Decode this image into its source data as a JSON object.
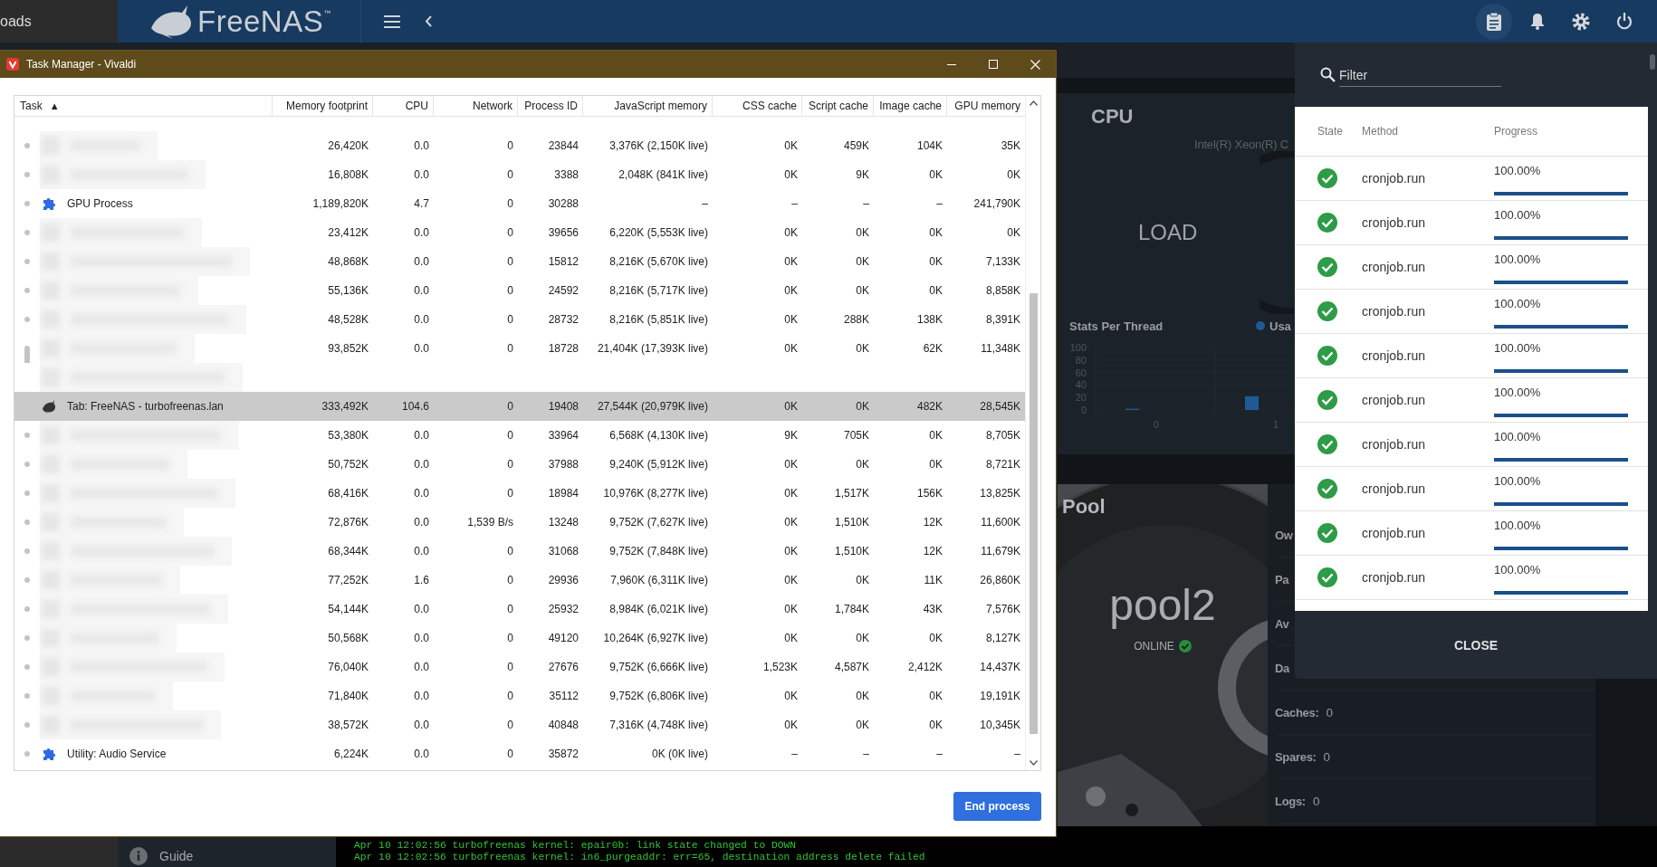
{
  "topbar": {
    "sidebar_fragment": "oads",
    "logo": "FreeNAS$^{™}$",
    "icons": [
      {
        "kind": "clipboard",
        "selected": true
      },
      {
        "kind": "bell",
        "selected": false
      },
      {
        "kind": "gear",
        "selected": false
      },
      {
        "kind": "power",
        "selected": false
      }
    ]
  },
  "task_manager": {
    "title": "Task Manager - Vivaldi",
    "columns": [
      {
        "label": "Task",
        "sort_indicator": "▲"
      },
      {
        "label": "Memory footprint"
      },
      {
        "label": "CPU"
      },
      {
        "label": "Network"
      },
      {
        "label": "Process ID"
      },
      {
        "label": "JavaScript memory"
      },
      {
        "label": "CSS cache"
      },
      {
        "label": "Script cache"
      },
      {
        "label": "Image cache"
      },
      {
        "label": "GPU memory"
      }
    ],
    "rows": [
      {
        "kind": "blurred",
        "dot": true,
        "grouped": false,
        "selected": false,
        "values": [
          "26,420K",
          "0.0",
          "0",
          "23844",
          "3,376K (2,150K live)",
          "0K",
          "459K",
          "104K",
          "35K"
        ]
      },
      {
        "kind": "blurred",
        "dot": true,
        "grouped": false,
        "selected": false,
        "values": [
          "16,808K",
          "0.0",
          "0",
          "3388",
          "2,048K (841K live)",
          "0K",
          "9K",
          "0K",
          "0K"
        ]
      },
      {
        "kind": "extension",
        "dot": true,
        "grouped": false,
        "selected": false,
        "task": "GPU Process",
        "values": [
          "1,189,820K",
          "4.7",
          "0",
          "30288",
          "–",
          "–",
          "–",
          "–",
          "241,790K"
        ]
      },
      {
        "kind": "blurred",
        "dot": true,
        "grouped": false,
        "selected": false,
        "values": [
          "23,412K",
          "0.0",
          "0",
          "39656",
          "6,220K (5,553K live)",
          "0K",
          "0K",
          "0K",
          "0K"
        ]
      },
      {
        "kind": "blurred",
        "dot": true,
        "grouped": false,
        "selected": false,
        "values": [
          "48,868K",
          "0.0",
          "0",
          "15812",
          "8,216K (5,670K live)",
          "0K",
          "0K",
          "0K",
          "7,133K"
        ]
      },
      {
        "kind": "blurred",
        "dot": true,
        "grouped": false,
        "selected": false,
        "values": [
          "55,136K",
          "0.0",
          "0",
          "24592",
          "8,216K (5,717K live)",
          "0K",
          "0K",
          "0K",
          "8,858K"
        ]
      },
      {
        "kind": "blurred",
        "dot": true,
        "grouped": false,
        "selected": false,
        "values": [
          "48,528K",
          "0.0",
          "0",
          "28732",
          "8,216K (5,851K live)",
          "0K",
          "288K",
          "138K",
          "8,391K"
        ]
      },
      {
        "kind": "blurred",
        "dot": false,
        "grouped": true,
        "selected": false,
        "values": [
          "93,852K",
          "0.0",
          "0",
          "18728",
          "21,404K (17,393K live)",
          "0K",
          "0K",
          "62K",
          "11,348K"
        ]
      },
      {
        "kind": "blurred",
        "dot": false,
        "grouped": false,
        "selected": false
      },
      {
        "kind": "tab",
        "dot": false,
        "grouped": false,
        "selected": true,
        "task": "Tab: FreeNAS - turbofreenas.lan",
        "values": [
          "333,492K",
          "104.6",
          "0",
          "19408",
          "27,544K (20,979K live)",
          "0K",
          "0K",
          "482K",
          "28,545K"
        ]
      },
      {
        "kind": "blurred",
        "dot": true,
        "grouped": false,
        "selected": false,
        "values": [
          "53,380K",
          "0.0",
          "0",
          "33964",
          "6,568K (4,130K live)",
          "9K",
          "705K",
          "0K",
          "8,705K"
        ]
      },
      {
        "kind": "blurred",
        "dot": true,
        "grouped": false,
        "selected": false,
        "values": [
          "50,752K",
          "0.0",
          "0",
          "37988",
          "9,240K (5,912K live)",
          "0K",
          "0K",
          "0K",
          "8,721K"
        ]
      },
      {
        "kind": "blurred",
        "dot": true,
        "grouped": false,
        "selected": false,
        "values": [
          "68,416K",
          "0.0",
          "0",
          "18984",
          "10,976K (8,277K live)",
          "0K",
          "1,517K",
          "156K",
          "13,825K"
        ]
      },
      {
        "kind": "blurred",
        "dot": true,
        "grouped": false,
        "selected": false,
        "values": [
          "72,876K",
          "0.0",
          "1,539 B/s",
          "13248",
          "9,752K (7,627K live)",
          "0K",
          "1,510K",
          "12K",
          "11,600K"
        ]
      },
      {
        "kind": "blurred",
        "dot": true,
        "grouped": false,
        "selected": false,
        "values": [
          "68,344K",
          "0.0",
          "0",
          "31068",
          "9,752K (7,848K live)",
          "0K",
          "1,510K",
          "12K",
          "11,679K"
        ]
      },
      {
        "kind": "blurred",
        "dot": true,
        "grouped": false,
        "selected": false,
        "values": [
          "77,252K",
          "1.6",
          "0",
          "29936",
          "7,960K (6,311K live)",
          "0K",
          "0K",
          "11K",
          "26,860K"
        ]
      },
      {
        "kind": "blurred",
        "dot": true,
        "grouped": false,
        "selected": false,
        "values": [
          "54,144K",
          "0.0",
          "0",
          "25932",
          "8,984K (6,021K live)",
          "0K",
          "1,784K",
          "43K",
          "7,576K"
        ]
      },
      {
        "kind": "blurred",
        "dot": true,
        "grouped": false,
        "selected": false,
        "values": [
          "50,568K",
          "0.0",
          "0",
          "49120",
          "10,264K (6,927K live)",
          "0K",
          "0K",
          "0K",
          "8,127K"
        ]
      },
      {
        "kind": "blurred",
        "dot": true,
        "grouped": false,
        "selected": false,
        "values": [
          "76,040K",
          "0.0",
          "0",
          "27676",
          "9,752K (6,666K live)",
          "1,523K",
          "4,587K",
          "2,412K",
          "14,437K"
        ]
      },
      {
        "kind": "blurred",
        "dot": true,
        "grouped": false,
        "selected": false,
        "values": [
          "71,840K",
          "0.0",
          "0",
          "35112",
          "9,752K (6,806K live)",
          "0K",
          "0K",
          "0K",
          "19,191K"
        ]
      },
      {
        "kind": "blurred",
        "dot": true,
        "grouped": false,
        "selected": false,
        "values": [
          "38,572K",
          "0.0",
          "0",
          "40848",
          "7,316K (4,748K live)",
          "0K",
          "0K",
          "0K",
          "10,345K"
        ]
      },
      {
        "kind": "extension",
        "dot": true,
        "grouped": false,
        "selected": false,
        "task": "Utility: Audio Service",
        "values": [
          "6,224K",
          "0.0",
          "0",
          "35872",
          "0K (0K live)",
          "–",
          "–",
          "–",
          "–"
        ]
      }
    ],
    "end_button": "End process"
  },
  "dashboard": {
    "cpu": {
      "title": "CPU",
      "model": "Intel(R) Xeon(R) C",
      "load_label": "LOAD",
      "chart_data": {
        "type": "bar",
        "title": "Stats Per Thread",
        "categories": [
          "0",
          "1"
        ],
        "series": [
          {
            "name": "Usa",
            "color": "#1f5a96",
            "values": [
              2,
              22
            ]
          }
        ],
        "ylim": [
          0,
          100
        ],
        "yticks": [
          0,
          20,
          40,
          60,
          80,
          100
        ]
      }
    },
    "pool": {
      "title": "Pool",
      "name": "pool2",
      "status": "ONLINE",
      "details": [
        {
          "label": "Ow"
        },
        {
          "label": "Pa"
        },
        {
          "label": "Av"
        },
        {
          "label": "Da"
        },
        {
          "label": "Caches:",
          "value": "0"
        },
        {
          "label": "Spares:",
          "value": "0"
        },
        {
          "label": "Logs:",
          "value": "0"
        }
      ]
    }
  },
  "task_drawer": {
    "filter_placeholder": "Filter",
    "columns": [
      "State",
      "Method",
      "Progress"
    ],
    "jobs": [
      {
        "succeeded": true,
        "method": "cronjob.run",
        "progress": "100.00%",
        "level": 1
      },
      {
        "succeeded": true,
        "method": "cronjob.run",
        "progress": "100.00%",
        "level": 1
      },
      {
        "succeeded": true,
        "method": "cronjob.run",
        "progress": "100.00%",
        "level": 1
      },
      {
        "succeeded": true,
        "method": "cronjob.run",
        "progress": "100.00%",
        "level": 1
      },
      {
        "succeeded": true,
        "method": "cronjob.run",
        "progress": "100.00%",
        "level": 1
      },
      {
        "succeeded": true,
        "method": "cronjob.run",
        "progress": "100.00%",
        "level": 1
      },
      {
        "succeeded": true,
        "method": "cronjob.run",
        "progress": "100.00%",
        "level": 1
      },
      {
        "succeeded": true,
        "method": "cronjob.run",
        "progress": "100.00%",
        "level": 1
      },
      {
        "succeeded": true,
        "method": "cronjob.run",
        "progress": "100.00%",
        "level": 1
      },
      {
        "succeeded": true,
        "method": "cronjob.run",
        "progress": "100.00%",
        "level": 1
      }
    ],
    "close": "CLOSE"
  },
  "sidebar": {
    "items": [
      {
        "label": "Guide"
      }
    ]
  },
  "console": {
    "lines": [
      "Apr 10 12:02:56 turbofreenas kernel: epair0b: link state changed to DOWN",
      "Apr 10 12:02:56 turbofreenas kernel: in6_purgeaddr: err=65, destination address delete failed"
    ]
  }
}
